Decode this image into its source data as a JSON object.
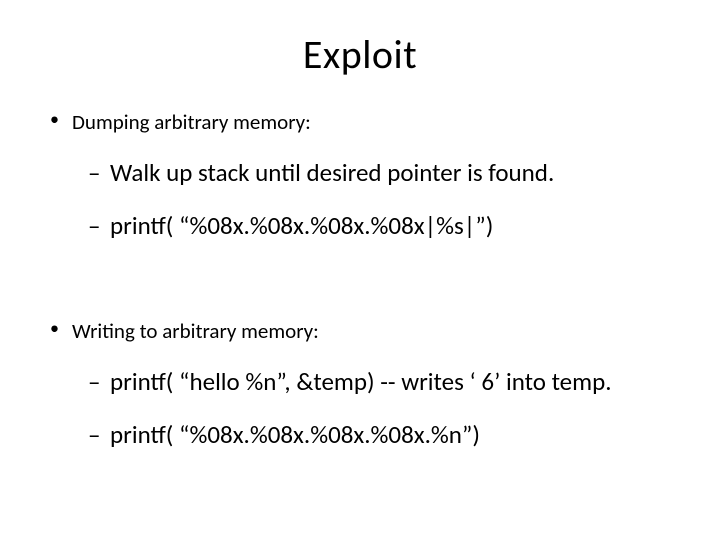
{
  "title": "Exploit",
  "section1": {
    "header": "Dumping arbitrary memory:",
    "items": [
      "Walk up stack until desired pointer is found.",
      "printf( “%08x.%08x.%08x.%08x|%s|”)"
    ]
  },
  "section2": {
    "header": "Writing to arbitrary memory:",
    "items": [
      "printf( “hello %n”, &temp)   --  writes ‘ 6’ into temp.",
      "printf( “%08x.%08x.%08x.%08x.%n”)"
    ]
  }
}
